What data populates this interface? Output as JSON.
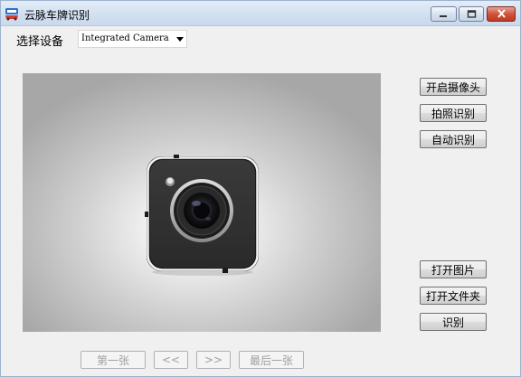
{
  "window": {
    "title": "云脉车牌识别",
    "icons": {
      "app": "car-plate-app-icon",
      "minimize": "minimize-icon",
      "maximize": "maximize-icon",
      "close": "close-icon"
    },
    "colors": {
      "close_button": "#c9432d",
      "titlebar": "#d6e3f2"
    }
  },
  "device": {
    "label": "选择设备",
    "selected": "Integrated Camera"
  },
  "preview": {
    "placeholder_icon": "camera-icon"
  },
  "buttons": {
    "open_camera": "开启摄像头",
    "capture_recognize": "拍照识别",
    "auto_recognize": "自动识别",
    "open_image": "打开图片",
    "open_folder": "打开文件夹",
    "recognize": "识别"
  },
  "navigation": {
    "first": "第一张",
    "prev": "<<",
    "next": ">>",
    "last": "最后一张"
  }
}
